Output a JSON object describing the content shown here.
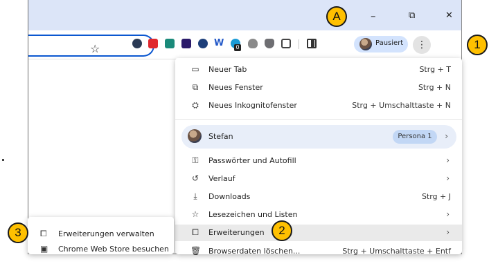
{
  "markers": {
    "a": "A",
    "one": "1",
    "two": "2",
    "three": "3"
  },
  "window_controls": {
    "minimize": "–",
    "restore": "⧉",
    "close": "✕"
  },
  "toolbar": {
    "star": "☆",
    "profile_label": "Pausiert",
    "menu_glyph": "⋮",
    "extension_badge": "0"
  },
  "menu": {
    "items": [
      {
        "icon": "▭",
        "label": "Neuer Tab",
        "shortcut": "Strg + T"
      },
      {
        "icon": "⧉",
        "label": "Neues Fenster",
        "shortcut": "Strg + N"
      },
      {
        "icon": "⛭",
        "label": "Neues Inkognitofenster",
        "shortcut": "Strg + Umschalttaste + N"
      },
      {
        "label": "Stefan",
        "badge": "Persona 1",
        "chevron": "›"
      },
      {
        "icon": "⚿",
        "label": "Passwörter und Autofill",
        "chevron": "›"
      },
      {
        "icon": "↺",
        "label": "Verlauf",
        "chevron": "›"
      },
      {
        "icon": "⤓",
        "label": "Downloads",
        "shortcut": "Strg + J"
      },
      {
        "icon": "☆",
        "label": "Lesezeichen und Listen",
        "chevron": "›"
      },
      {
        "icon": "⧠",
        "label": "Erweiterungen",
        "chevron": "›"
      },
      {
        "icon": "🗑",
        "label": "Browserdaten löschen...",
        "shortcut": "Strg + Umschalttaste + Entf"
      }
    ]
  },
  "submenu": {
    "items": [
      {
        "icon": "⧠",
        "label": "Erweiterungen verwalten"
      },
      {
        "icon": "▣",
        "label": "Chrome Web Store besuchen"
      }
    ]
  },
  "colors": {
    "accent": "#0b57d0",
    "marker": "#ffc000",
    "titlebar": "#dce5f8",
    "profile_chip": "#d3e3fd"
  }
}
